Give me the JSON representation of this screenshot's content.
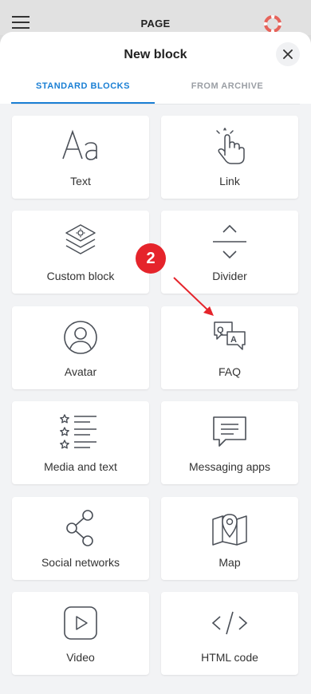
{
  "topbar": {
    "title": "PAGE"
  },
  "sheet": {
    "title": "New block",
    "tabs": [
      {
        "label": "STANDARD BLOCKS",
        "active": true
      },
      {
        "label": "FROM ARCHIVE",
        "active": false
      }
    ]
  },
  "blocks": [
    {
      "label": "Text",
      "icon": "text-icon"
    },
    {
      "label": "Link",
      "icon": "pointer-hand-icon"
    },
    {
      "label": "Custom block",
      "icon": "layers-icon"
    },
    {
      "label": "Divider",
      "icon": "divider-icon"
    },
    {
      "label": "Avatar",
      "icon": "avatar-icon"
    },
    {
      "label": "FAQ",
      "icon": "faq-icon"
    },
    {
      "label": "Media and text",
      "icon": "media-text-icon"
    },
    {
      "label": "Messaging apps",
      "icon": "chat-icon"
    },
    {
      "label": "Social networks",
      "icon": "share-icon"
    },
    {
      "label": "Map",
      "icon": "map-icon"
    },
    {
      "label": "Video",
      "icon": "video-icon"
    },
    {
      "label": "HTML code",
      "icon": "code-icon"
    }
  ],
  "annotation": {
    "step": "2"
  },
  "colors": {
    "accent": "#1a7fd4",
    "badge": "#e5242b",
    "icon": "#4a4f57"
  }
}
